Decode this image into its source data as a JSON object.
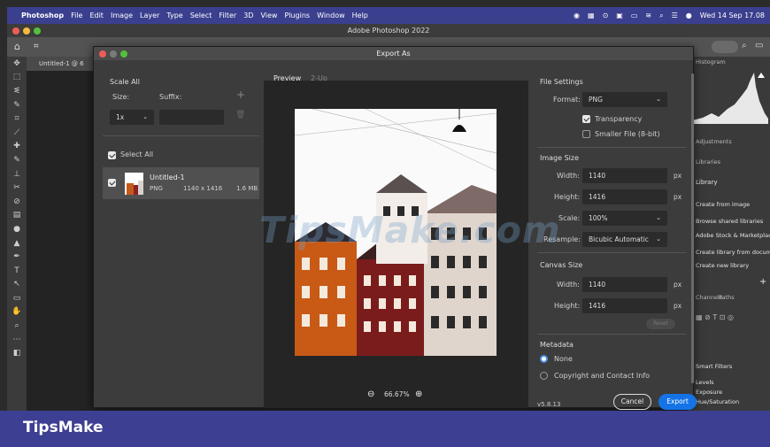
{
  "menubar": {
    "app": "Photoshop",
    "items": [
      "File",
      "Edit",
      "Image",
      "Layer",
      "Type",
      "Select",
      "Filter",
      "3D",
      "View",
      "Plugins",
      "Window",
      "Help"
    ],
    "clock": "Wed 14 Sep 17.08"
  },
  "window": {
    "title": "Adobe Photoshop 2022"
  },
  "document": {
    "tab": "Untitled-1 @ 6"
  },
  "dialog": {
    "title": "Export As",
    "scale_all": {
      "heading": "Scale All",
      "size_label": "Size:",
      "suffix_label": "Suffix:",
      "size_value": "1x",
      "suffix_value": ""
    },
    "select_all": {
      "label": "Select All",
      "checked": true
    },
    "asset": {
      "name": "Untitled-1",
      "format": "PNG",
      "dimensions": "1140 x 1416",
      "filesize": "1.6 MB",
      "checked": true
    },
    "tabs": [
      "Preview",
      "2-Up"
    ],
    "active_tab": "Preview",
    "zoom": "66.67%",
    "version": "v5.8.13",
    "file_settings": {
      "heading": "File Settings",
      "format_label": "Format:",
      "format_value": "PNG",
      "transparency_label": "Transparency",
      "transparency_checked": true,
      "smaller_file_label": "Smaller File (8-bit)",
      "smaller_file_checked": false
    },
    "image_size": {
      "heading": "Image Size",
      "width_label": "Width:",
      "width_value": "1140",
      "width_unit": "px",
      "height_label": "Height:",
      "height_value": "1416",
      "height_unit": "px",
      "scale_label": "Scale:",
      "scale_value": "100%",
      "resample_label": "Resample:",
      "resample_value": "Bicubic Automatic"
    },
    "canvas_size": {
      "heading": "Canvas Size",
      "width_label": "Width:",
      "width_value": "1140",
      "width_unit": "px",
      "height_label": "Height:",
      "height_value": "1416",
      "height_unit": "px",
      "reset_label": "Reset"
    },
    "metadata": {
      "heading": "Metadata",
      "options": [
        "None",
        "Copyright and Contact Info"
      ],
      "selected": "None"
    },
    "cancel_label": "Cancel",
    "export_label": "Export"
  },
  "right_panels": {
    "histogram_tab": "Histogram",
    "adjustments_tab": "Adjustments",
    "libraries_tab": "Libraries",
    "library_label": "Library",
    "items": [
      "Create from image",
      "Browse shared libraries",
      "Adobe Stock & Marketplace",
      "Create library from document",
      "Create new library"
    ],
    "channels_tab": "Channels",
    "paths_tab": "Paths",
    "filters": [
      "Smart Filters",
      "Levels",
      "Exposure",
      "Hue/Saturation"
    ]
  },
  "watermark": "TipsMake.com",
  "footer": {
    "brand": "TipsMake"
  },
  "colors": {
    "menubar": "#3a3f8e",
    "footer": "#3d3f93",
    "accent": "#1473e6"
  }
}
